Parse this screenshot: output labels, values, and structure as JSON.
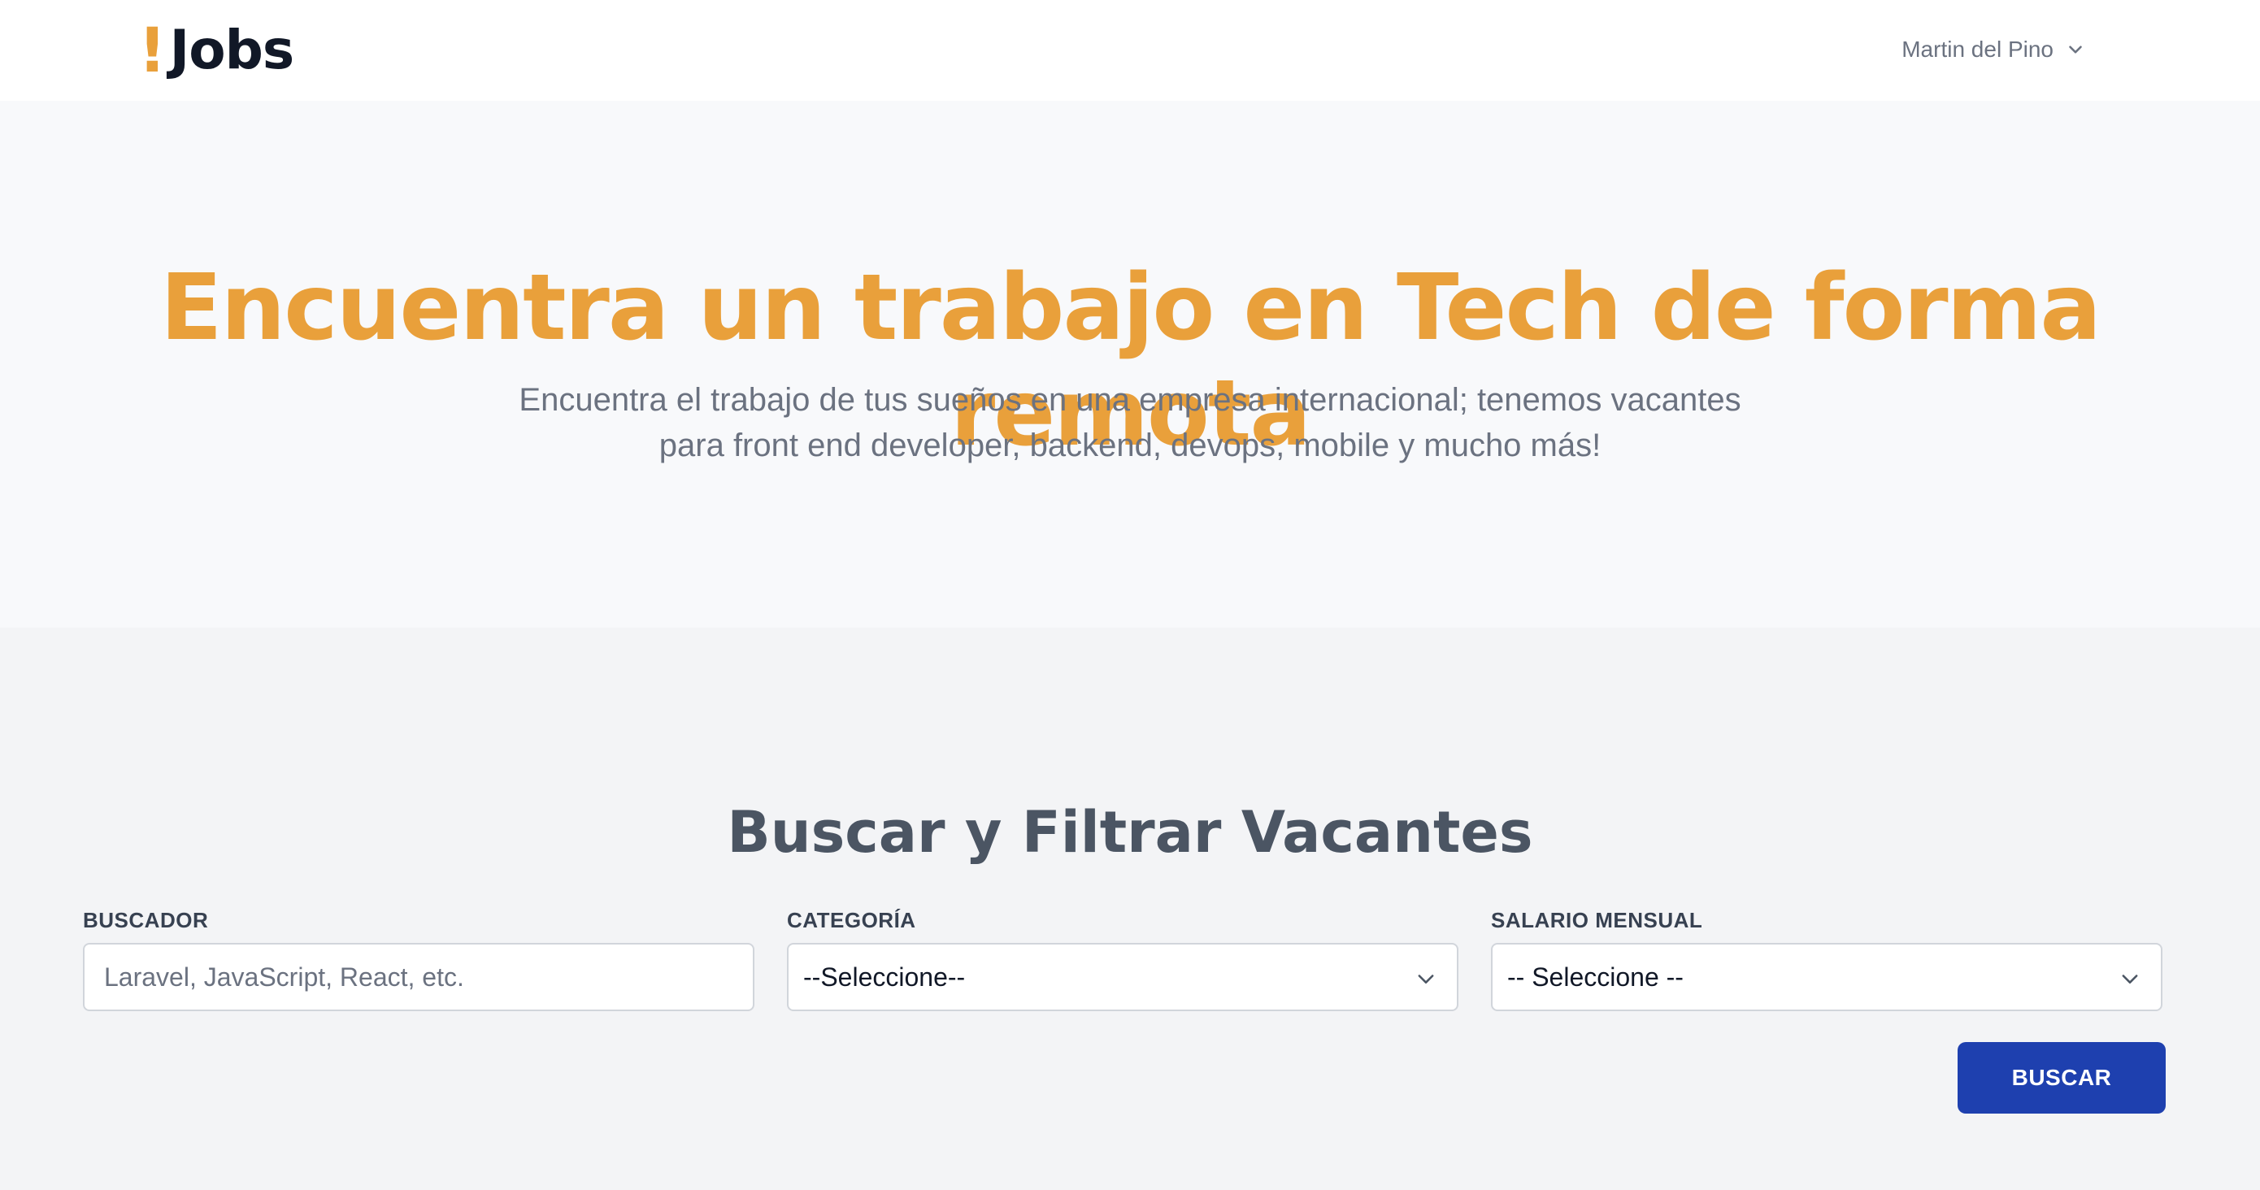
{
  "header": {
    "logo_mark": "!",
    "logo_text": "Jobs",
    "user_name": "Martin del Pino",
    "user_menu_icon": "chevron-down-icon"
  },
  "hero": {
    "title": "Encuentra un trabajo en Tech de forma remota",
    "subtitle": "Encuentra el trabajo de tus sueños en una empresa internacional; tenemos vacantes para front end developer, backend, devops, mobile y mucho más!"
  },
  "search": {
    "title": "Buscar y Filtrar Vacantes",
    "buscador": {
      "label": "BUSCADOR",
      "placeholder": "Laravel, JavaScript, React, etc.",
      "value": ""
    },
    "categoria": {
      "label": "CATEGORÍA",
      "selected": "--Seleccione--"
    },
    "salario": {
      "label": "SALARIO MENSUAL",
      "selected": "-- Seleccione --"
    },
    "button_label": "BUSCAR"
  },
  "colors": {
    "accent": "#e9a03b",
    "primary_button": "#1e40af",
    "hero_background": "#f8f9fb",
    "page_background": "#f3f4f6"
  }
}
